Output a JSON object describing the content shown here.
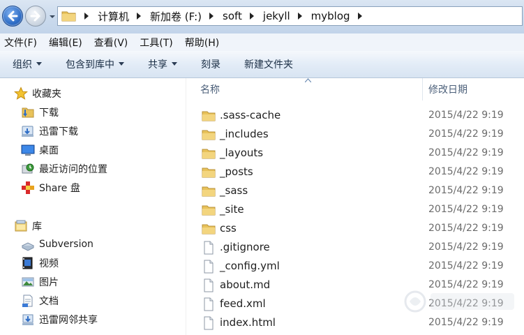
{
  "address_bar": {
    "breadcrumbs": [
      "计算机",
      "新加卷 (F:)",
      "soft",
      "jekyll",
      "myblog"
    ]
  },
  "menu": [
    "文件(F)",
    "编辑(E)",
    "查看(V)",
    "工具(T)",
    "帮助(H)"
  ],
  "toolbar": {
    "organize": "组织",
    "include_in_library": "包含到库中",
    "share": "共享",
    "burn": "刻录",
    "new_folder": "新建文件夹"
  },
  "nav": {
    "favorites": "收藏夹",
    "favorites_items": [
      "下载",
      "迅雷下载",
      "桌面",
      "最近访问的位置",
      "Share 盘"
    ],
    "libraries": "库",
    "library_items": [
      "Subversion",
      "视频",
      "图片",
      "文档",
      "迅雷网邻共享"
    ]
  },
  "columns": {
    "name": "名称",
    "modified": "修改日期"
  },
  "files": [
    {
      "name": ".sass-cache",
      "date": "2015/4/22 9:19",
      "type": "folder"
    },
    {
      "name": "_includes",
      "date": "2015/4/22 9:19",
      "type": "folder"
    },
    {
      "name": "_layouts",
      "date": "2015/4/22 9:19",
      "type": "folder"
    },
    {
      "name": "_posts",
      "date": "2015/4/22 9:19",
      "type": "folder"
    },
    {
      "name": "_sass",
      "date": "2015/4/22 9:19",
      "type": "folder"
    },
    {
      "name": "_site",
      "date": "2015/4/22 9:19",
      "type": "folder"
    },
    {
      "name": "css",
      "date": "2015/4/22 9:19",
      "type": "folder"
    },
    {
      "name": ".gitignore",
      "date": "2015/4/22 9:19",
      "type": "file"
    },
    {
      "name": "_config.yml",
      "date": "2015/4/22 9:19",
      "type": "file"
    },
    {
      "name": "about.md",
      "date": "2015/4/22 9:19",
      "type": "file"
    },
    {
      "name": "feed.xml",
      "date": "2015/4/22 9:19",
      "type": "file"
    },
    {
      "name": "index.html",
      "date": "2015/4/22 9:19",
      "type": "file"
    }
  ],
  "colors": {
    "folder": "#e8c25a",
    "accent": "#2e6dc6",
    "toolbar_text": "#1a2e45"
  }
}
